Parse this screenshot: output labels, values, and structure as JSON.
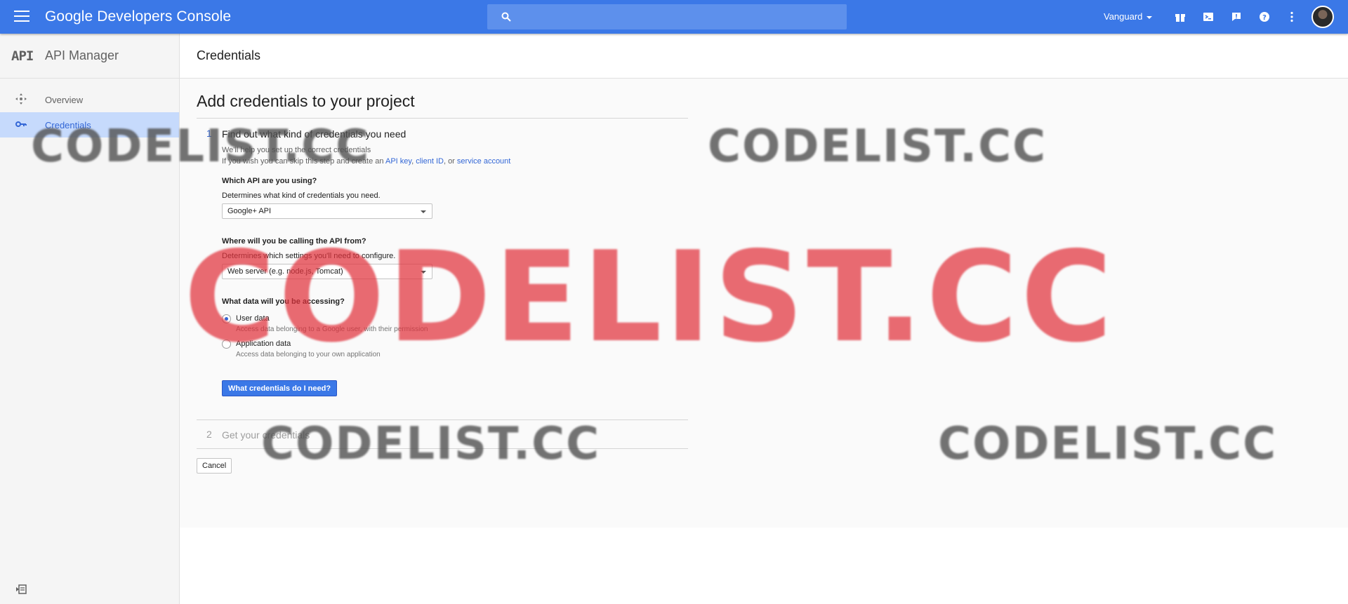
{
  "topbar": {
    "brand_google": "Google",
    "brand_product": "Developers Console",
    "project": "Vanguard"
  },
  "sidebar": {
    "logo": "API",
    "title": "API Manager",
    "items": [
      {
        "label": "Overview",
        "icon": "overview-icon"
      },
      {
        "label": "Credentials",
        "icon": "key-icon"
      }
    ]
  },
  "page": {
    "header": "Credentials",
    "heading": "Add credentials to your project",
    "step1": {
      "number": "1",
      "title": "Find out what kind of credentials you need",
      "intro": "We'll help you set up the correct credentials",
      "skip_prefix": "If you wish you can skip this step and create an",
      "link_api_key": "API key",
      "link_client_id": "client ID",
      "link_or": ", or",
      "link_service_account": "service account"
    },
    "q_api": {
      "label": "Which API are you using?",
      "help": "Determines what kind of credentials you need.",
      "value": "Google+ API"
    },
    "q_from": {
      "label": "Where will you be calling the API from?",
      "help": "Determines which settings you'll need to configure.",
      "value": "Web server (e.g. node.js, Tomcat)"
    },
    "q_data": {
      "label": "What data will you be accessing?",
      "options": [
        {
          "label": "User data",
          "sub": "Access data belonging to a Google user, with their permission",
          "selected": true
        },
        {
          "label": "Application data",
          "sub": "Access data belonging to your own application",
          "selected": false
        }
      ]
    },
    "primary_button": "What credentials do I need?",
    "step2": {
      "number": "2",
      "title": "Get your credentials"
    },
    "cancel": "Cancel"
  },
  "watermarks": [
    "CODELIST.CC",
    "CODELIST.CC",
    "CODELIST.CC",
    "CODELIST.CC",
    "CODELIST.CC"
  ],
  "colors": {
    "accent": "#3b78e7",
    "link": "#3367d6",
    "sidebar_active": "#c6dafc",
    "watermark_red": "#e1323c"
  }
}
